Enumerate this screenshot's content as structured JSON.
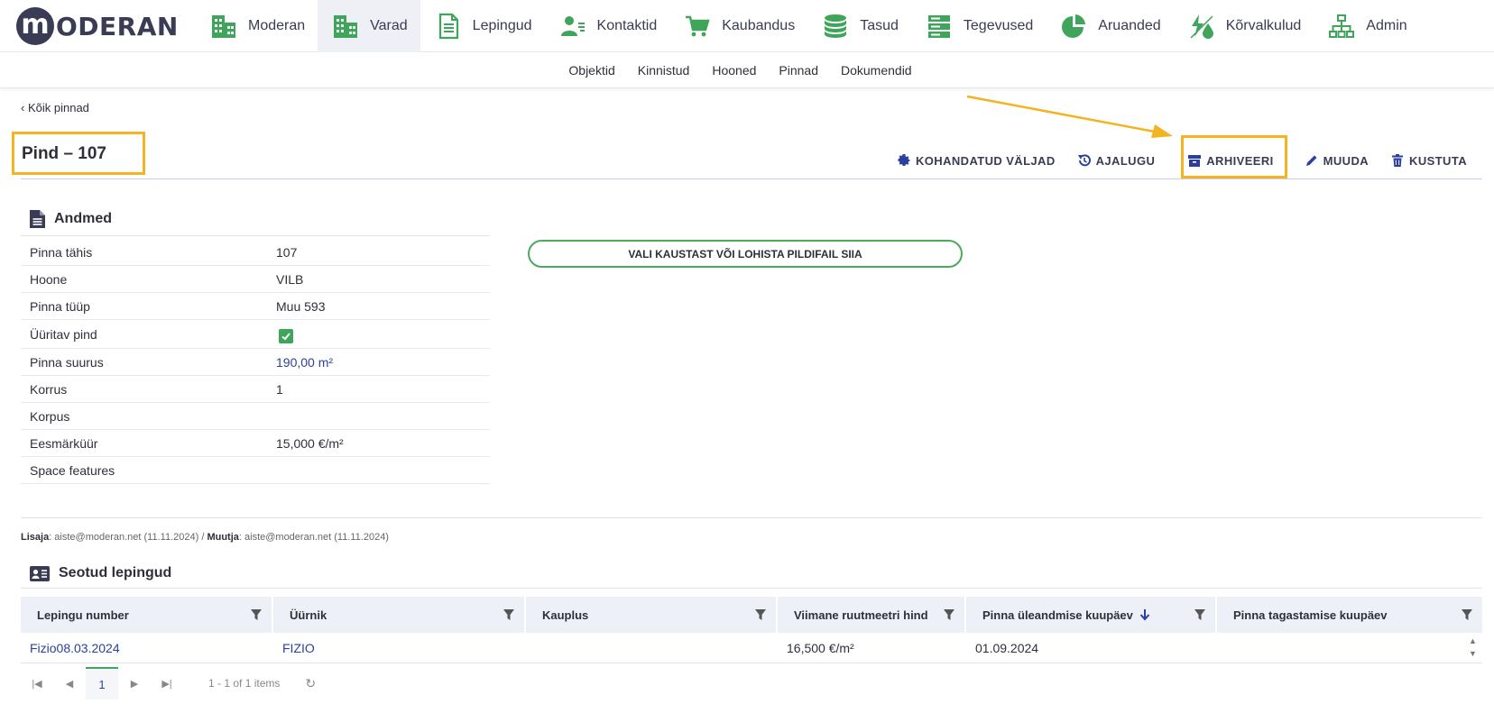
{
  "brand": {
    "logo_letter": "m",
    "logo_text": "ODERAN"
  },
  "nav": [
    {
      "label": "Moderan",
      "icon": "building-icon"
    },
    {
      "label": "Varad",
      "icon": "building-icon"
    },
    {
      "label": "Lepingud",
      "icon": "document-icon"
    },
    {
      "label": "Kontaktid",
      "icon": "contact-icon"
    },
    {
      "label": "Kaubandus",
      "icon": "cart-icon"
    },
    {
      "label": "Tasud",
      "icon": "coins-icon"
    },
    {
      "label": "Tegevused",
      "icon": "server-icon"
    },
    {
      "label": "Aruanded",
      "icon": "pie-chart-icon"
    },
    {
      "label": "Kõrvalkulud",
      "icon": "utilities-icon"
    },
    {
      "label": "Admin",
      "icon": "sitemap-icon"
    }
  ],
  "nav_active": "Varad",
  "subnav": [
    "Objektid",
    "Kinnistud",
    "Hooned",
    "Pinnad",
    "Dokumendid"
  ],
  "back_link": "Kõik pinnad",
  "page_title": "Pind – 107",
  "toolbar": {
    "custom_fields": "KOHANDATUD VÄLJAD",
    "history": "AJALUGU",
    "archive": "ARHIVEERI",
    "edit": "MUUDA",
    "delete": "KUSTUTA"
  },
  "andmed": {
    "title": "Andmed",
    "rows": [
      {
        "label": "Pinna tähis",
        "value": "107"
      },
      {
        "label": "Hoone",
        "value": "VILB"
      },
      {
        "label": "Pinna tüüp",
        "value": "Muu 593"
      },
      {
        "label": "Üüritav pind",
        "value": "",
        "checked": true
      },
      {
        "label": "Pinna suurus",
        "value": "190,00 m²"
      },
      {
        "label": "Korrus",
        "value": "1"
      },
      {
        "label": "Korpus",
        "value": ""
      },
      {
        "label": "Eesmärküür",
        "value": "15,000 €/m²"
      },
      {
        "label": "Space features",
        "value": ""
      }
    ]
  },
  "upload_label": "VALI KAUSTAST VÕI LOHISTA PILDIFAIL SIIA",
  "meta": {
    "added_label": "Lisaja",
    "added_value": ": aiste@moderan.net (11.11.2024) / ",
    "changed_label": "Muutja",
    "changed_value": ": aiste@moderan.net (11.11.2024)"
  },
  "contracts": {
    "title": "Seotud lepingud",
    "columns": [
      "Lepingu number",
      "Üürnik",
      "Kauplus",
      "Viimane ruutmeetri hind",
      "Pinna üleandmise kuupäev",
      "Pinna tagastamise kuupäev"
    ],
    "rows": [
      [
        "Fizio08.03.2024",
        "FIZIO",
        "",
        "16,500 €/m²",
        "01.09.2024",
        ""
      ]
    ]
  },
  "pager": {
    "current": "1",
    "info": "1 - 1 of 1 items"
  },
  "colors": {
    "accent_green": "#3ea55a",
    "brand_dark": "#3a3b55",
    "link_blue": "#2b3fa0",
    "highlight": "#f4b320"
  }
}
